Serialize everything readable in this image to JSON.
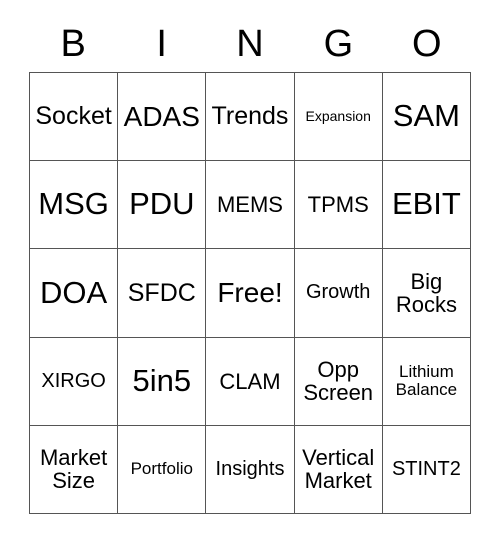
{
  "card": {
    "title": "BINGO",
    "header_letters": [
      "B",
      "I",
      "N",
      "G",
      "O"
    ],
    "grid_size": "5x5",
    "free_space": "Free!",
    "colors": {
      "background": "#ffffff",
      "text": "#000000",
      "border": "#555555"
    },
    "columns": {
      "B": [
        "Socket",
        "MSG",
        "DOA",
        "XIRGO",
        "Market\nSize"
      ],
      "I": [
        "ADAS",
        "PDU",
        "SFDC",
        "5in5",
        "Portfolio"
      ],
      "N": [
        "Trends",
        "MEMS",
        "Free!",
        "CLAM",
        "Insights"
      ],
      "G": [
        "Expansion",
        "TPMS",
        "Growth",
        "Opp\nScreen",
        "Vertical\nMarket"
      ],
      "O": [
        "SAM",
        "EBIT",
        "Big\nRocks",
        "Lithium\nBalance",
        "STINT2"
      ]
    },
    "rows": [
      [
        {
          "text": "Socket",
          "size": "fs-l"
        },
        {
          "text": "ADAS",
          "size": "fs-xl"
        },
        {
          "text": "Trends",
          "size": "fs-l"
        },
        {
          "text": "Expansion",
          "size": "fs-xs"
        },
        {
          "text": "SAM",
          "size": "fs-xxl"
        }
      ],
      [
        {
          "text": "MSG",
          "size": "fs-xxl"
        },
        {
          "text": "PDU",
          "size": "fs-xxl"
        },
        {
          "text": "MEMS",
          "size": "fs-ml"
        },
        {
          "text": "TPMS",
          "size": "fs-ml"
        },
        {
          "text": "EBIT",
          "size": "fs-xxl"
        }
      ],
      [
        {
          "text": "DOA",
          "size": "fs-xxl"
        },
        {
          "text": "SFDC",
          "size": "fs-l"
        },
        {
          "text": "Free!",
          "size": "fs-xl"
        },
        {
          "text": "Growth",
          "size": "fs-m"
        },
        {
          "text": "Big\nRocks",
          "size": "fs-ml"
        }
      ],
      [
        {
          "text": "XIRGO",
          "size": "fs-m"
        },
        {
          "text": "5in5",
          "size": "fs-xxl"
        },
        {
          "text": "CLAM",
          "size": "fs-ml"
        },
        {
          "text": "Opp\nScreen",
          "size": "fs-ml"
        },
        {
          "text": "Lithium\nBalance",
          "size": "fs-s"
        }
      ],
      [
        {
          "text": "Market\nSize",
          "size": "fs-ml"
        },
        {
          "text": "Portfolio",
          "size": "fs-s"
        },
        {
          "text": "Insights",
          "size": "fs-m"
        },
        {
          "text": "Vertical\nMarket",
          "size": "fs-ml"
        },
        {
          "text": "STINT2",
          "size": "fs-m"
        }
      ]
    ]
  }
}
